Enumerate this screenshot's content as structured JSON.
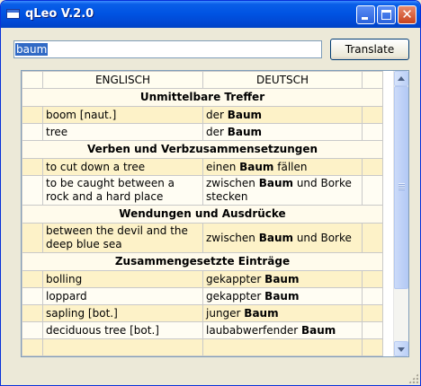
{
  "window": {
    "title": "qLeo V.2.0"
  },
  "search": {
    "value": "baum",
    "button_label": "Translate"
  },
  "table": {
    "headers": [
      "ENGLISCH",
      "DEUTSCH"
    ],
    "rows": [
      {
        "type": "section",
        "label": "Unmittelbare Treffer"
      },
      {
        "type": "entry",
        "en": "boom [naut.]",
        "de": [
          {
            "t": "der "
          },
          {
            "t": "Baum",
            "b": true
          }
        ]
      },
      {
        "type": "entry",
        "en": "tree",
        "de": [
          {
            "t": "der "
          },
          {
            "t": "Baum",
            "b": true
          }
        ]
      },
      {
        "type": "section",
        "label": "Verben und Verbzusammensetzungen"
      },
      {
        "type": "entry",
        "en": "to cut down a tree",
        "de": [
          {
            "t": "einen "
          },
          {
            "t": "Baum",
            "b": true
          },
          {
            "t": " fällen"
          }
        ]
      },
      {
        "type": "entry",
        "en": "to be caught between a rock and a hard place",
        "de": [
          {
            "t": "zwischen "
          },
          {
            "t": "Baum",
            "b": true
          },
          {
            "t": " und Borke stecken"
          }
        ]
      },
      {
        "type": "section",
        "label": "Wendungen und Ausdrücke"
      },
      {
        "type": "entry",
        "en": "between the devil and the deep blue sea",
        "de": [
          {
            "t": "zwischen "
          },
          {
            "t": "Baum",
            "b": true
          },
          {
            "t": " und Borke"
          }
        ]
      },
      {
        "type": "section",
        "label": "Zusammengesetzte Einträge"
      },
      {
        "type": "entry",
        "en": "bolling",
        "de": [
          {
            "t": "gekappter "
          },
          {
            "t": "Baum",
            "b": true
          }
        ]
      },
      {
        "type": "entry",
        "en": "loppard",
        "de": [
          {
            "t": "gekappter "
          },
          {
            "t": "Baum",
            "b": true
          }
        ]
      },
      {
        "type": "entry",
        "en": "sapling [bot.]",
        "de": [
          {
            "t": "junger "
          },
          {
            "t": "Baum",
            "b": true
          }
        ]
      },
      {
        "type": "entry",
        "en": "deciduous tree [bot.]",
        "de": [
          {
            "t": "laubabwerfender "
          },
          {
            "t": "Baum",
            "b": true
          }
        ]
      },
      {
        "type": "entry",
        "en": "",
        "de": []
      }
    ]
  }
}
